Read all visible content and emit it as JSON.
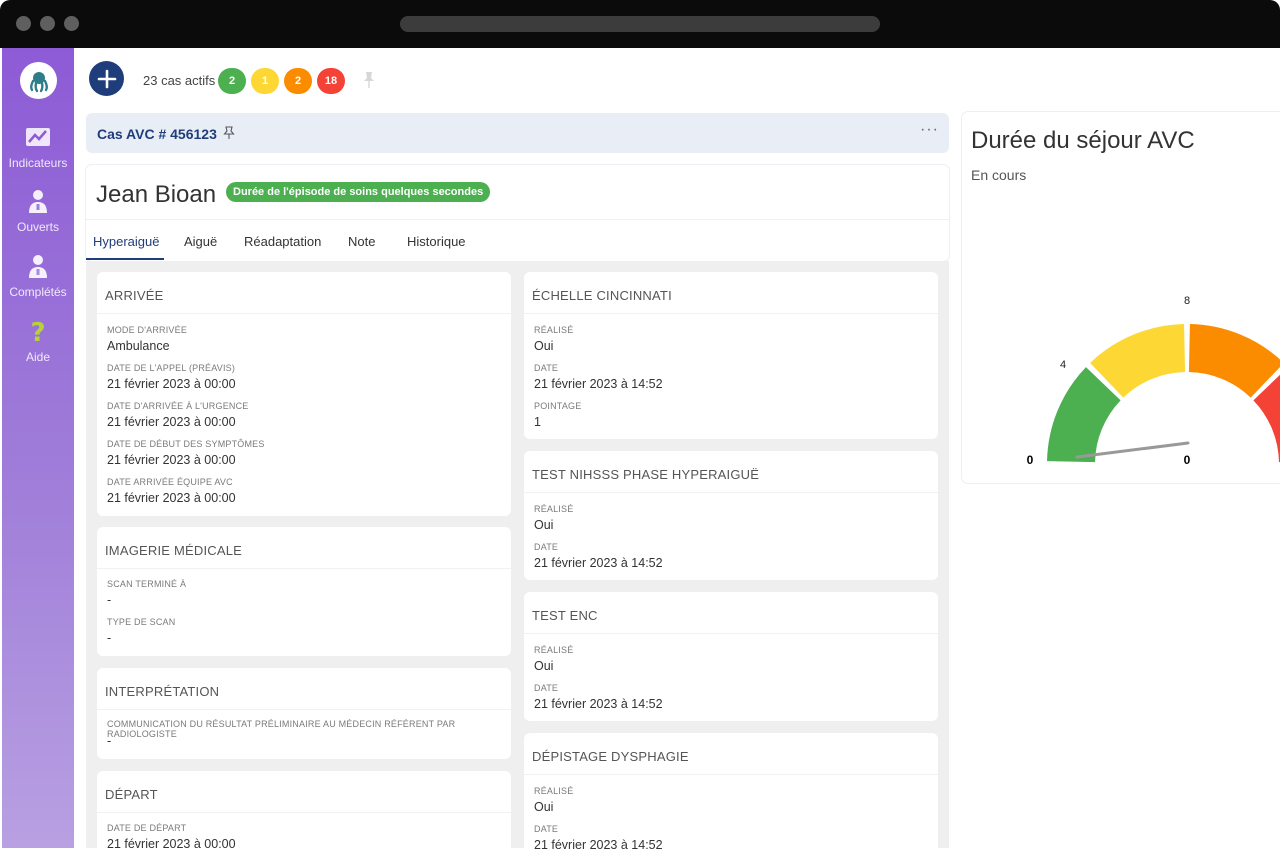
{
  "topbar": {
    "active_cases": "23 cas actifs",
    "badges": {
      "green": "2",
      "yellow": "1",
      "orange": "2",
      "red": "18"
    }
  },
  "sidebar": {
    "items": [
      {
        "label": "Indicateurs",
        "icon": "chart-icon"
      },
      {
        "label": "Ouverts",
        "icon": "doctor-icon"
      },
      {
        "label": "Complétés",
        "icon": "doctor-icon"
      },
      {
        "label": "Aide",
        "icon": "question-icon"
      }
    ]
  },
  "case": {
    "title": "Cas AVC # 456123",
    "more": "···"
  },
  "patient": {
    "name": "Jean Bioan",
    "episode_badge": "Durée de l'épisode de soins quelques secondes"
  },
  "tabs": [
    "Hyperaiguë",
    "Aiguë",
    "Réadaptation",
    "Note",
    "Historique"
  ],
  "cards": {
    "arrivee": {
      "title": "ARRIVÉE",
      "fields": [
        {
          "label": "MODE D'ARRIVÉE",
          "value": "Ambulance"
        },
        {
          "label": "DATE DE L'APPEL (PRÉAVIS)",
          "value": "21 février 2023 à 00:00"
        },
        {
          "label": "DATE D'ARRIVÉE À L'URGENCE",
          "value": "21 février 2023 à 00:00"
        },
        {
          "label": "DATE DE DÉBUT DES SYMPTÔMES",
          "value": "21 février 2023 à 00:00"
        },
        {
          "label": "DATE ARRIVÉE ÉQUIPE AVC",
          "value": "21 février 2023 à 00:00"
        }
      ]
    },
    "imagerie": {
      "title": "IMAGERIE MÉDICALE",
      "fields": [
        {
          "label": "SCAN TERMINÉ À",
          "value": "-"
        },
        {
          "label": "TYPE DE SCAN",
          "value": "-"
        }
      ]
    },
    "interpretation": {
      "title": "INTERPRÉTATION",
      "fields": [
        {
          "label": "COMMUNICATION DU RÉSULTAT PRÉLIMINAIRE AU MÉDECIN RÉFÉRENT PAR RADIOLOGISTE",
          "value": "-"
        }
      ]
    },
    "depart": {
      "title": "DÉPART",
      "fields": [
        {
          "label": "DATE DE DÉPART",
          "value": "21 février 2023 à 00:00"
        }
      ]
    },
    "cincinnati": {
      "title": "ÉCHELLE CINCINNATI",
      "fields": [
        {
          "label": "RÉALISÉ",
          "value": "Oui"
        },
        {
          "label": "DATE",
          "value": "21 février 2023 à 14:52"
        },
        {
          "label": "POINTAGE",
          "value": "1"
        }
      ]
    },
    "nihsss": {
      "title": "TEST NIHSSS PHASE HYPERAIGUË",
      "fields": [
        {
          "label": "RÉALISÉ",
          "value": "Oui"
        },
        {
          "label": "DATE",
          "value": "21 février 2023 à 14:52"
        }
      ]
    },
    "enc": {
      "title": "TEST ENC",
      "fields": [
        {
          "label": "RÉALISÉ",
          "value": "Oui"
        },
        {
          "label": "DATE",
          "value": "21 février 2023 à 14:52"
        }
      ]
    },
    "dysphagie": {
      "title": "DÉPISTAGE DYSPHAGIE",
      "fields": [
        {
          "label": "RÉALISÉ",
          "value": "Oui"
        },
        {
          "label": "DATE",
          "value": "21 février 2023 à 14:52"
        }
      ]
    }
  },
  "duration": {
    "title": "Durée du séjour AVC",
    "subtitle": "En cours",
    "gauge": {
      "min_label": "0",
      "labels": [
        "4",
        "8"
      ],
      "value_label": "0",
      "value": 0,
      "colors": {
        "green": "#4caf50",
        "yellow": "#fdd835",
        "orange": "#fb8c00",
        "red": "#f44336"
      }
    }
  }
}
